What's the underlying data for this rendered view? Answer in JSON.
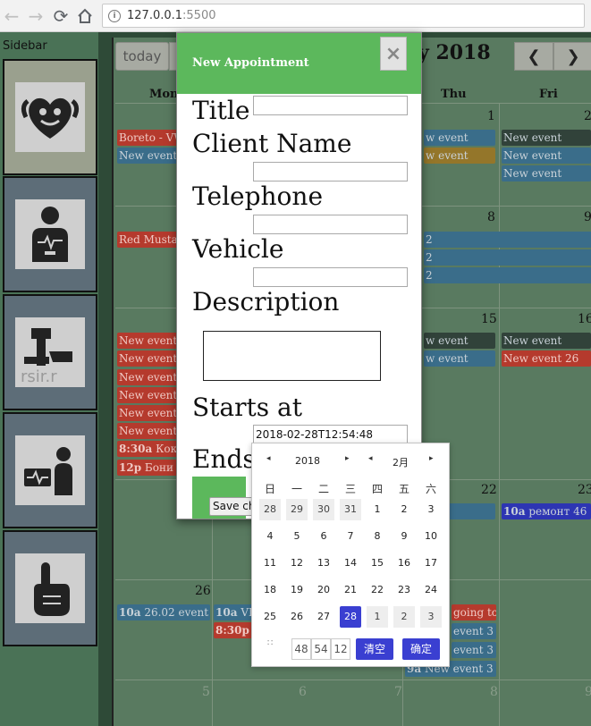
{
  "browser": {
    "back_icon": "arrow-left",
    "forward_icon": "arrow-right",
    "reload_icon": "reload",
    "home_icon": "home",
    "url_host": "127.0.0.1",
    "url_port": ":5500"
  },
  "sidebar": {
    "title": "Sidebar",
    "items": [
      {
        "icon": "heart-muscle-icon"
      },
      {
        "icon": "heart-monitor-person-icon"
      },
      {
        "icon": "hand-device-icon"
      },
      {
        "icon": "tablet-ekg-icon"
      },
      {
        "icon": "hand-gesture-icon"
      }
    ]
  },
  "calendar": {
    "today_label": "today",
    "title_fragment": "y 2018",
    "prev_icon": "chevron-left",
    "next_icon": "chevron-right",
    "dow": {
      "mon": "Mon",
      "thu": "Thu",
      "fri": "Fri"
    },
    "day_numbers": {
      "r1_thu": "1",
      "r1_fri": "2",
      "r2_thu": "8",
      "r2_fri": "9",
      "r3_thu": "15",
      "r3_fri": "16",
      "r4_thu": "22",
      "r4_fri": "23",
      "r5_mon": "26",
      "r6_mon": "5",
      "r6_tue": "6",
      "r6_wed": "7",
      "r6_thu": "8",
      "r6_fri": "9"
    },
    "events": {
      "e1": "Boreto - VW",
      "e2": "New event",
      "e3": "w event",
      "e4": "New event",
      "e5": "w event",
      "e6": "New event",
      "e7": "New event",
      "e8": "Red Mustang",
      "e9": "2",
      "e10": "2",
      "e11": "2",
      "e12": "New event",
      "e13": "New event",
      "e14": "New event",
      "e15": "New event",
      "e16": "New event",
      "e17": "New event",
      "e18_time": "8:30a",
      "e18_text": "Коко",
      "e19_time": "12p",
      "e19_text": "Бони -",
      "e20": "w event",
      "e21": "New event",
      "e22": "w event",
      "e23": "New event 26",
      "e24_time": "10a",
      "e24_text": "ремонт 46",
      "e25_time": "10a",
      "e25_text": "26.02 event",
      "e26_time": "10a",
      "e26_text": "VIF",
      "e27_time": "8:30p",
      "e27_text": "B",
      "e28": "going to",
      "e29": "event 3",
      "e30": "event 3",
      "e31_time": "9a",
      "e31_text": "New event 3"
    }
  },
  "modal": {
    "title": "New Appointment",
    "close_label": "×",
    "labels": {
      "title": "Title",
      "client": "Client Name",
      "phone": "Telephone",
      "vehicle": "Vehicle",
      "description": "Description",
      "starts": "Starts at",
      "ends": "Ends"
    },
    "values": {
      "title": "",
      "client": "",
      "phone": "",
      "vehicle": "",
      "starts": "2018-02-28T12:54:48"
    },
    "save_label": "Save changes"
  },
  "picker": {
    "prev_year": "◂",
    "year": "2018",
    "next_year": "▸",
    "prev_month": "◂",
    "month": "2月",
    "next_month": "▸",
    "weekdays": [
      "日",
      "一",
      "二",
      "三",
      "四",
      "五",
      "六"
    ],
    "weeks": [
      [
        "28",
        "29",
        "30",
        "31",
        "1",
        "2",
        "3"
      ],
      [
        "4",
        "5",
        "6",
        "7",
        "8",
        "9",
        "10"
      ],
      [
        "11",
        "12",
        "13",
        "14",
        "15",
        "16",
        "17"
      ],
      [
        "18",
        "19",
        "20",
        "21",
        "22",
        "23",
        "24"
      ],
      [
        "25",
        "26",
        "27",
        "28",
        "1",
        "2",
        "3"
      ]
    ],
    "time_icon": "∷",
    "hour": "48",
    "minute": "54",
    "second": "12",
    "clear_label": "清空",
    "ok_label": "确定"
  }
}
